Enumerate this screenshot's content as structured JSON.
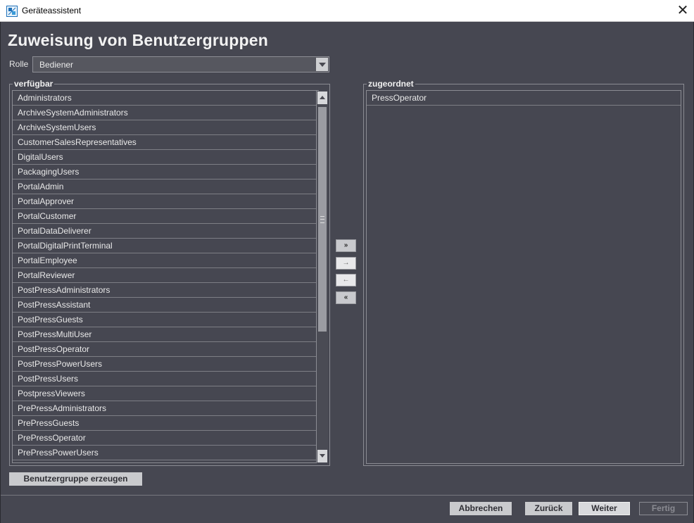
{
  "window": {
    "title": "Geräteassistent",
    "close": "✕"
  },
  "page": {
    "heading": "Zuweisung von Benutzergruppen"
  },
  "role": {
    "label": "Rolle",
    "value": "Bediener"
  },
  "available": {
    "title": "verfügbar",
    "items": [
      "Administrators",
      "ArchiveSystemAdministrators",
      "ArchiveSystemUsers",
      "CustomerSalesRepresentatives",
      "DigitalUsers",
      "PackagingUsers",
      "PortalAdmin",
      "PortalApprover",
      "PortalCustomer",
      "PortalDataDeliverer",
      "PortalDigitalPrintTerminal",
      "PortalEmployee",
      "PortalReviewer",
      "PostPressAdministrators",
      "PostPressAssistant",
      "PostPressGuests",
      "PostPressMultiUser",
      "PostPressOperator",
      "PostPressPowerUsers",
      "PostPressUsers",
      "PostpressViewers",
      "PrePressAdministrators",
      "PrePressGuests",
      "PrePressOperator",
      "PrePressPowerUsers"
    ]
  },
  "assigned": {
    "title": "zugeordnet",
    "items": [
      "PressOperator"
    ]
  },
  "move_buttons": {
    "add_all": "»",
    "add": "→",
    "remove": "←",
    "remove_all": "«"
  },
  "actions": {
    "create_group": "Benutzergruppe erzeugen",
    "cancel": "Abbrechen",
    "back": "Zurück",
    "next": "Weiter",
    "finish": "Fertig"
  }
}
